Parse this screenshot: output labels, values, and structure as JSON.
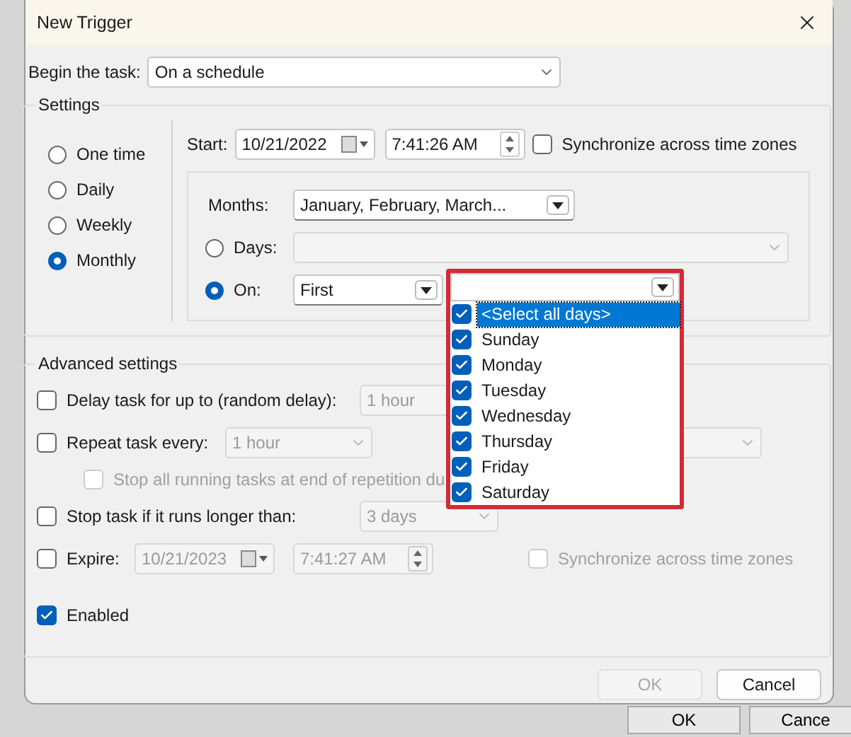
{
  "window": {
    "title": "New Trigger"
  },
  "begin_task": {
    "label": "Begin the task:",
    "value": "On a schedule"
  },
  "settings": {
    "title": "Settings",
    "schedules": [
      {
        "label": "One time",
        "selected": false
      },
      {
        "label": "Daily",
        "selected": false
      },
      {
        "label": "Weekly",
        "selected": false
      },
      {
        "label": "Monthly",
        "selected": true
      }
    ],
    "start": {
      "label": "Start:",
      "date": "10/21/2022",
      "time": "7:41:26 AM"
    },
    "sync": {
      "label": "Synchronize across time zones",
      "checked": false
    },
    "months": {
      "label": "Months:",
      "value": "January, February, March..."
    },
    "days": {
      "label": "Days:",
      "selected": false
    },
    "on": {
      "label": "On:",
      "selected": true,
      "week": "First"
    },
    "weekday_list": [
      {
        "label": "<Select all days>",
        "checked": true,
        "selected": true
      },
      {
        "label": "Sunday",
        "checked": true,
        "selected": false
      },
      {
        "label": "Monday",
        "checked": true,
        "selected": false
      },
      {
        "label": "Tuesday",
        "checked": true,
        "selected": false
      },
      {
        "label": "Wednesday",
        "checked": true,
        "selected": false
      },
      {
        "label": "Thursday",
        "checked": true,
        "selected": false
      },
      {
        "label": "Friday",
        "checked": true,
        "selected": false
      },
      {
        "label": "Saturday",
        "checked": true,
        "selected": false
      }
    ]
  },
  "advanced": {
    "title": "Advanced settings",
    "delay": {
      "label": "Delay task for up to (random delay):",
      "checked": false,
      "value": "1 hour"
    },
    "repeat": {
      "label": "Repeat task every:",
      "checked": false,
      "value": "1 hour"
    },
    "stop_repetition": {
      "label": "Stop all running tasks at end of repetition du",
      "checked": false,
      "disabled": true
    },
    "stop_task": {
      "label": "Stop task if it runs longer than:",
      "checked": false,
      "value": "3 days"
    },
    "expire": {
      "label": "Expire:",
      "checked": false,
      "date": "10/21/2023",
      "time": "7:41:27 AM"
    },
    "expire_sync": {
      "label": "Synchronize across time zones",
      "checked": false,
      "disabled": true
    },
    "enabled": {
      "label": "Enabled",
      "checked": true
    }
  },
  "buttons": [
    {
      "label": "OK",
      "disabled": true
    },
    {
      "label": "Cancel",
      "disabled": false
    }
  ],
  "background_buttons": [
    "OK",
    "Cance"
  ]
}
